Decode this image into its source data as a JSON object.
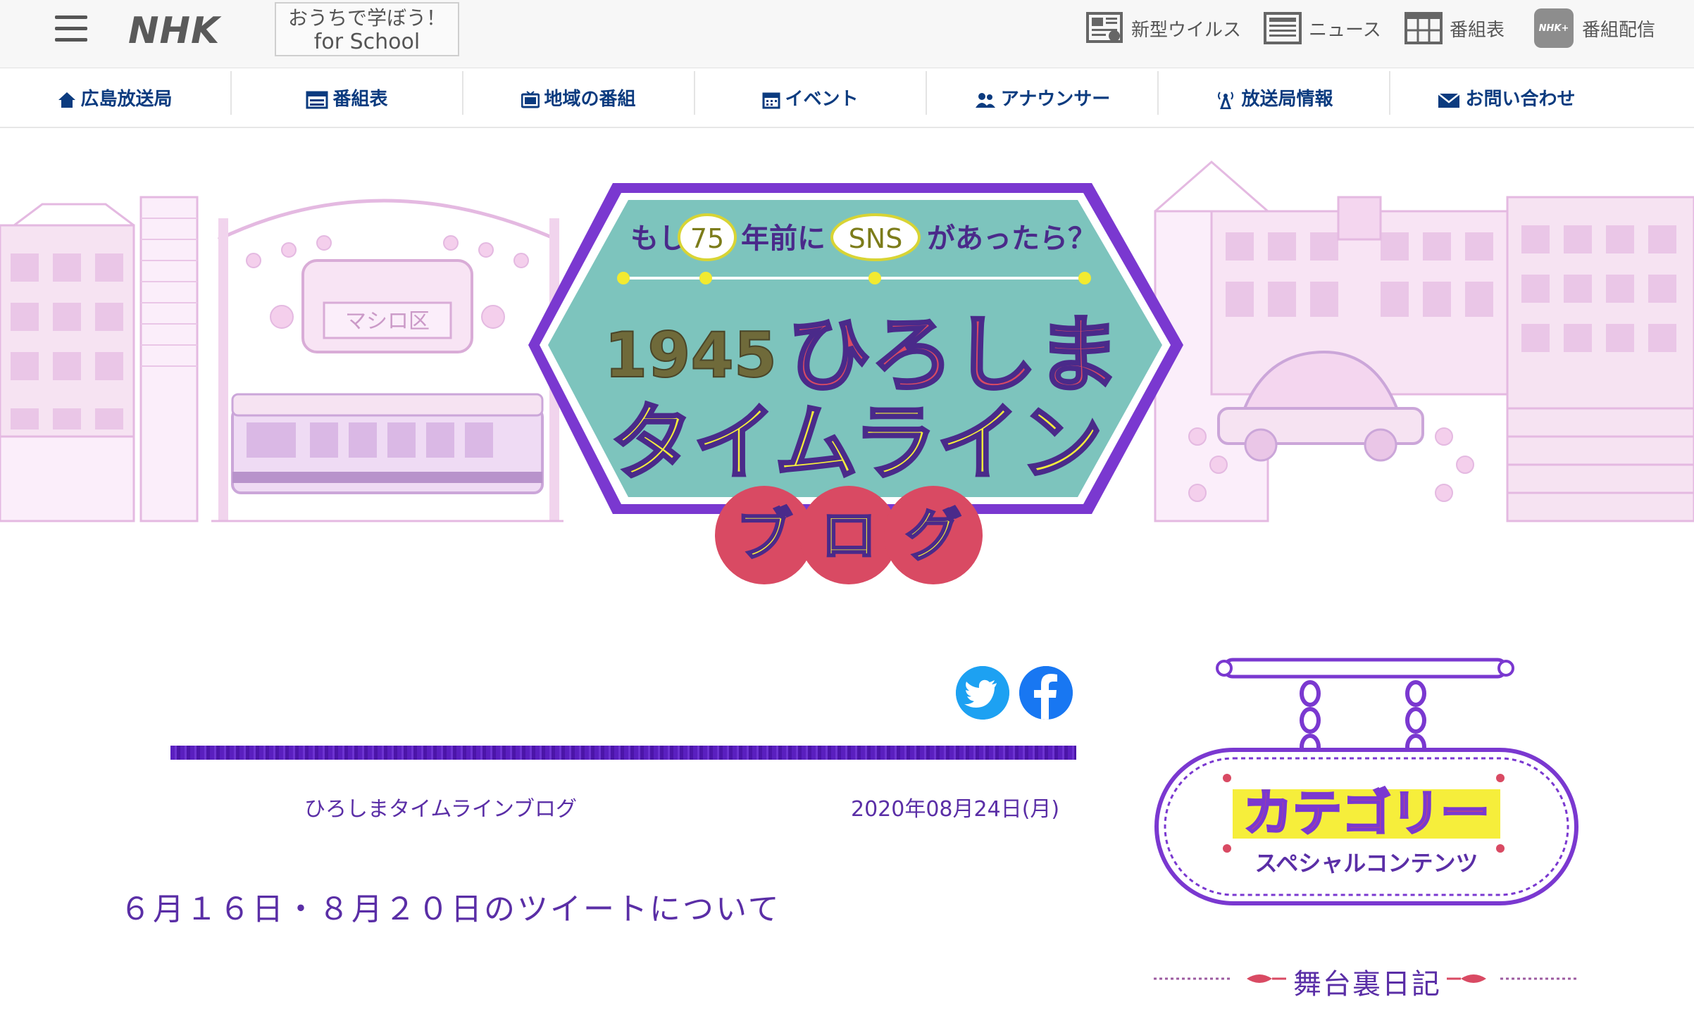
{
  "header": {
    "logo": "NHK",
    "school_line1": "おうちで学ぼう！",
    "school_line2": "for School",
    "utility": [
      {
        "label": "新型ウイルス",
        "icon": "virus-news-icon"
      },
      {
        "label": "ニュース",
        "icon": "news-icon"
      },
      {
        "label": "番組表",
        "icon": "schedule-grid-icon"
      },
      {
        "label": "番組配信",
        "icon": "nhk-plus-icon",
        "badge": "NHK+"
      }
    ]
  },
  "nav": {
    "items": [
      {
        "label": "広島放送局",
        "icon": "home-icon"
      },
      {
        "label": "番組表",
        "icon": "tv-guide-icon"
      },
      {
        "label": "地域の番組",
        "icon": "tv-icon"
      },
      {
        "label": "イベント",
        "icon": "calendar-icon"
      },
      {
        "label": "アナウンサー",
        "icon": "people-icon"
      },
      {
        "label": "放送局情報",
        "icon": "antenna-icon"
      },
      {
        "label": "お問い合わせ",
        "icon": "mail-icon"
      }
    ]
  },
  "banner": {
    "tagline_pre": "もし",
    "tagline_num": "75",
    "tagline_mid": "年前に",
    "tagline_sns": "SNS",
    "tagline_post": "があったら？",
    "year": "1945",
    "title_red": "ひろしま",
    "title_yellow": "タイムライン",
    "blog": [
      "ブ",
      "ロ",
      "グ"
    ],
    "station_sign": "マシロ区"
  },
  "article": {
    "category": "ひろしまタイムラインブログ",
    "date": "2020年08月24日(月)",
    "title": "６月１６日・８月２０日のツイートについて"
  },
  "sidebar": {
    "sign_title": "カテゴリー",
    "sign_subtitle": "スペシャルコンテンツ",
    "link": "舞台裏日記"
  },
  "colors": {
    "purple": "#5a2ea6",
    "nav_text": "#0b3b7f",
    "teal": "#79c3bd",
    "red": "#d94a63",
    "yellow": "#f6ee3b",
    "twitter": "#1da1f2",
    "facebook": "#1877f2"
  }
}
